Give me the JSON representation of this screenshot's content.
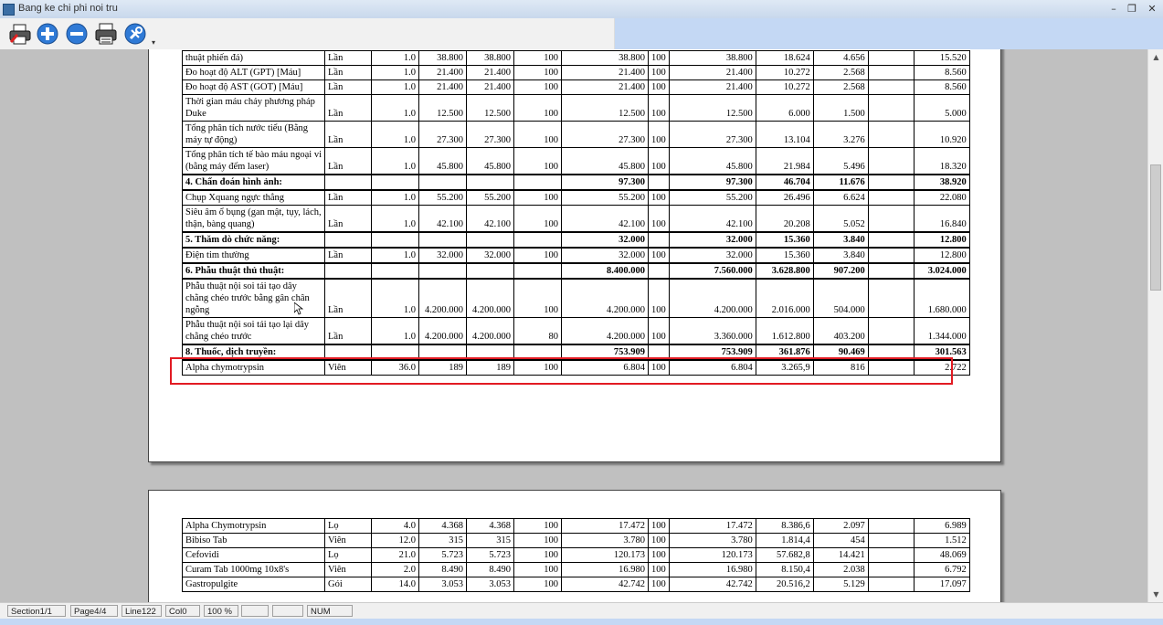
{
  "window": {
    "title": "Bang ke chi phi noi tru",
    "min": "–",
    "max": "❐",
    "close": "✕"
  },
  "toolbar": {
    "icons": [
      "print-setup-icon",
      "zoom-in-icon",
      "zoom-out-icon",
      "print-icon",
      "tools-icon"
    ],
    "more": "▾"
  },
  "page1_rows": [
    {
      "type": "item",
      "c": [
        "thuật phiến đá)",
        "Lần",
        "1.0",
        "38.800",
        "38.800",
        "100",
        "38.800",
        "100",
        "38.800",
        "18.624",
        "4.656",
        "",
        "15.520"
      ]
    },
    {
      "type": "item",
      "c": [
        "Đo hoạt độ ALT (GPT) [Máu]",
        "Lần",
        "1.0",
        "21.400",
        "21.400",
        "100",
        "21.400",
        "100",
        "21.400",
        "10.272",
        "2.568",
        "",
        "8.560"
      ]
    },
    {
      "type": "item",
      "c": [
        "Đo hoạt độ AST (GOT) [Máu]",
        "Lần",
        "1.0",
        "21.400",
        "21.400",
        "100",
        "21.400",
        "100",
        "21.400",
        "10.272",
        "2.568",
        "",
        "8.560"
      ]
    },
    {
      "type": "item",
      "c": [
        "Thời gian máu chảy phương pháp Duke",
        "Lần",
        "1.0",
        "12.500",
        "12.500",
        "100",
        "12.500",
        "100",
        "12.500",
        "6.000",
        "1.500",
        "",
        "5.000"
      ]
    },
    {
      "type": "item",
      "c": [
        "Tổng phân tích nước tiểu (Bằng máy tự động)",
        "Lần",
        "1.0",
        "27.300",
        "27.300",
        "100",
        "27.300",
        "100",
        "27.300",
        "13.104",
        "3.276",
        "",
        "10.920"
      ]
    },
    {
      "type": "item",
      "c": [
        "Tổng phân tích tế bào máu ngoại vi (bằng máy đếm laser)",
        "Lần",
        "1.0",
        "45.800",
        "45.800",
        "100",
        "45.800",
        "100",
        "45.800",
        "21.984",
        "5.496",
        "",
        "18.320"
      ]
    },
    {
      "type": "sec",
      "c": [
        "4. Chẩn đoán hình ảnh:",
        "",
        "",
        "",
        "",
        "",
        "97.300",
        "",
        "97.300",
        "46.704",
        "11.676",
        "",
        "38.920"
      ]
    },
    {
      "type": "item",
      "c": [
        "Chụp Xquang ngực thẳng",
        "Lần",
        "1.0",
        "55.200",
        "55.200",
        "100",
        "55.200",
        "100",
        "55.200",
        "26.496",
        "6.624",
        "",
        "22.080"
      ]
    },
    {
      "type": "item",
      "c": [
        "Siêu âm ổ bụng (gan mật, tụy, lách, thận, bàng quang)",
        "Lần",
        "1.0",
        "42.100",
        "42.100",
        "100",
        "42.100",
        "100",
        "42.100",
        "20.208",
        "5.052",
        "",
        "16.840"
      ]
    },
    {
      "type": "sec",
      "c": [
        "5. Thăm dò chức năng:",
        "",
        "",
        "",
        "",
        "",
        "32.000",
        "",
        "32.000",
        "15.360",
        "3.840",
        "",
        "12.800"
      ]
    },
    {
      "type": "item",
      "c": [
        "Điện tim thường",
        "Lần",
        "1.0",
        "32.000",
        "32.000",
        "100",
        "32.000",
        "100",
        "32.000",
        "15.360",
        "3.840",
        "",
        "12.800"
      ]
    },
    {
      "type": "sec",
      "c": [
        "6. Phẫu thuật thủ thuật:",
        "",
        "",
        "",
        "",
        "",
        "8.400.000",
        "",
        "7.560.000",
        "3.628.800",
        "907.200",
        "",
        "3.024.000"
      ]
    },
    {
      "type": "item",
      "c": [
        "Phẫu thuật nội soi tái tạo dây chằng chéo trước bằng gân chân ngỗng",
        "Lần",
        "1.0",
        "4.200.000",
        "4.200.000",
        "100",
        "4.200.000",
        "100",
        "4.200.000",
        "2.016.000",
        "504.000",
        "",
        "1.680.000"
      ]
    },
    {
      "type": "item",
      "c": [
        "Phẫu thuật nội soi tái tạo lại dây chằng chéo trước",
        "Lần",
        "1.0",
        "4.200.000",
        "4.200.000",
        "80",
        "4.200.000",
        "100",
        "3.360.000",
        "1.612.800",
        "403.200",
        "",
        "1.344.000"
      ]
    },
    {
      "type": "sec",
      "c": [
        "8. Thuốc, dịch truyền:",
        "",
        "",
        "",
        "",
        "",
        "753.909",
        "",
        "753.909",
        "361.876",
        "90.469",
        "",
        "301.563"
      ]
    },
    {
      "type": "item",
      "c": [
        "Alpha chymotrypsin",
        "Viên",
        "36.0",
        "189",
        "189",
        "100",
        "6.804",
        "100",
        "6.804",
        "3.265,9",
        "816",
        "",
        "2.722"
      ]
    }
  ],
  "page2_rows": [
    {
      "type": "item",
      "c": [
        "Alpha Chymotrypsin",
        "Lọ",
        "4.0",
        "4.368",
        "4.368",
        "100",
        "17.472",
        "100",
        "17.472",
        "8.386,6",
        "2.097",
        "",
        "6.989"
      ]
    },
    {
      "type": "item",
      "c": [
        "Bibiso Tab",
        "Viên",
        "12.0",
        "315",
        "315",
        "100",
        "3.780",
        "100",
        "3.780",
        "1.814,4",
        "454",
        "",
        "1.512"
      ]
    },
    {
      "type": "item",
      "c": [
        "Cefovidi",
        "Lọ",
        "21.0",
        "5.723",
        "5.723",
        "100",
        "120.173",
        "100",
        "120.173",
        "57.682,8",
        "14.421",
        "",
        "48.069"
      ]
    },
    {
      "type": "item",
      "c": [
        "Curam Tab 1000mg 10x8's",
        "Viên",
        "2.0",
        "8.490",
        "8.490",
        "100",
        "16.980",
        "100",
        "16.980",
        "8.150,4",
        "2.038",
        "",
        "6.792"
      ]
    },
    {
      "type": "item",
      "c": [
        "Gastropulgite",
        "Gói",
        "14.0",
        "3.053",
        "3.053",
        "100",
        "42.742",
        "100",
        "42.742",
        "20.516,2",
        "5.129",
        "",
        "17.097"
      ]
    }
  ],
  "status": {
    "section": "Section1/1",
    "page": "Page4/4",
    "line": "Line122",
    "col": "Col0",
    "zoom": "100 %",
    "blank1": "",
    "blank2": "",
    "num": "NUM"
  },
  "scrollbar": {
    "up": "▲",
    "down": "▼"
  },
  "colors": {
    "highlight": "#e21b23",
    "toolbar": "#c4d8f4"
  }
}
